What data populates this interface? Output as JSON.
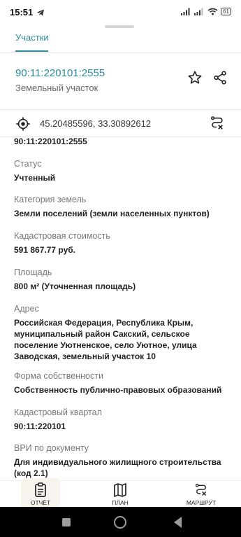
{
  "status_bar": {
    "time": "15:51",
    "battery": "61"
  },
  "tabs": {
    "active": "Участки"
  },
  "header": {
    "cad_number": "90:11:220101:2555",
    "object_type": "Земельный участок"
  },
  "coords": {
    "text": "45.20485596, 33.30892612"
  },
  "content": {
    "partial_top": "90:11:220101:2555",
    "fields": [
      {
        "label": "Статус",
        "value": "Учтенный"
      },
      {
        "label": "Категория земель",
        "value": "Земли поселений (земли населенных пунктов)"
      },
      {
        "label": "Кадастровая стоимость",
        "value": "591 867.77 руб."
      },
      {
        "label": "Площадь",
        "value": "800 м² (Уточненная площадь)"
      },
      {
        "label": "Адрес",
        "value": "Российская Федерация, Республика Крым, муниципальный район Сакский, сельское поселение Уютненское, село Уютное, улица Заводская, земельный участок 10"
      },
      {
        "label": "Форма собственности",
        "value": "Собственность публично-правовых образований"
      },
      {
        "label": "Кадастровый квартал",
        "value": "90:11:220101"
      },
      {
        "label": "ВРИ по документу",
        "value": "Для индивидуального жилищного строительства (код 2.1)"
      }
    ]
  },
  "bottom_nav": {
    "report": "ОТЧЁТ",
    "plan": "ПЛАН",
    "route": "МАРШРУТ"
  },
  "colors": {
    "accent": "#2a8b9a"
  }
}
